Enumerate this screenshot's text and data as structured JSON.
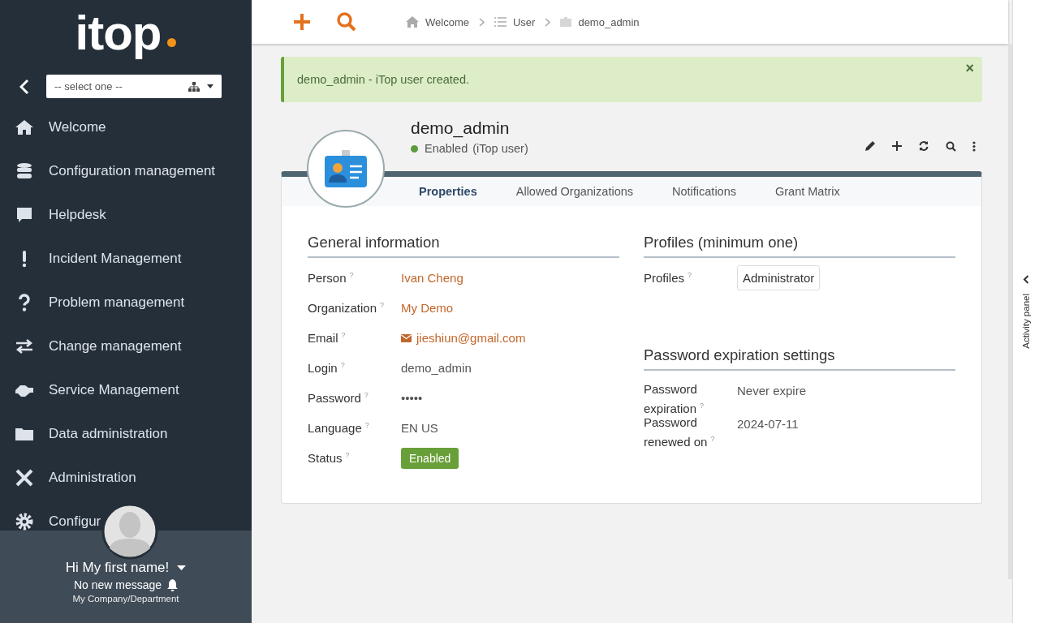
{
  "sidebar": {
    "logo": "itop",
    "org_select": {
      "placeholder": "-- select one --"
    },
    "menu": [
      {
        "label": "Welcome"
      },
      {
        "label": "Configuration management"
      },
      {
        "label": "Helpdesk"
      },
      {
        "label": "Incident Management"
      },
      {
        "label": "Problem management"
      },
      {
        "label": "Change management"
      },
      {
        "label": "Service Management"
      },
      {
        "label": "Data administration"
      },
      {
        "label": "Administration"
      },
      {
        "label": "Configur"
      }
    ],
    "user": {
      "greeting": "Hi My first name!",
      "messages": "No new message",
      "org": "My Company/Department"
    }
  },
  "breadcrumb": [
    {
      "label": "Welcome"
    },
    {
      "label": "User"
    },
    {
      "label": "demo_admin"
    }
  ],
  "alert": {
    "message": "demo_admin - iTop user created.",
    "close": "×"
  },
  "object": {
    "name": "demo_admin",
    "status": "Enabled",
    "class": "(iTop user)",
    "tabs": [
      {
        "label": "Properties",
        "selected": true
      },
      {
        "label": "Allowed Organizations",
        "selected": false
      },
      {
        "label": "Notifications",
        "selected": false
      },
      {
        "label": "Grant Matrix",
        "selected": false
      }
    ],
    "general": {
      "title": "General information",
      "fields": [
        {
          "label": "Person",
          "help": "?",
          "value": "Ivan Cheng",
          "kind": "link"
        },
        {
          "label": "Organization",
          "help": "?",
          "value": "My Demo",
          "kind": "link"
        },
        {
          "label": "Email",
          "help": "?",
          "value": "jieshiun@gmail.com",
          "kind": "email"
        },
        {
          "label": "Login",
          "help": "?",
          "value": "demo_admin",
          "kind": "text"
        },
        {
          "label": "Password",
          "help": "?",
          "value": "•••••",
          "kind": "text"
        },
        {
          "label": "Language",
          "help": "?",
          "value": "EN US",
          "kind": "text"
        },
        {
          "label": "Status",
          "help": "?",
          "value": "Enabled",
          "kind": "badge"
        }
      ]
    },
    "profiles": {
      "title": "Profiles (minimum one)",
      "label": "Profiles",
      "help": "?",
      "values": [
        "Administrator"
      ]
    },
    "password": {
      "title": "Password expiration settings",
      "fields": [
        {
          "label": "Password expiration",
          "help": "?",
          "value": "Never expire"
        },
        {
          "label": "Password renewed on",
          "help": "?",
          "value": "2024-07-11"
        }
      ]
    }
  },
  "activity_panel": {
    "label": "Activity panel"
  }
}
